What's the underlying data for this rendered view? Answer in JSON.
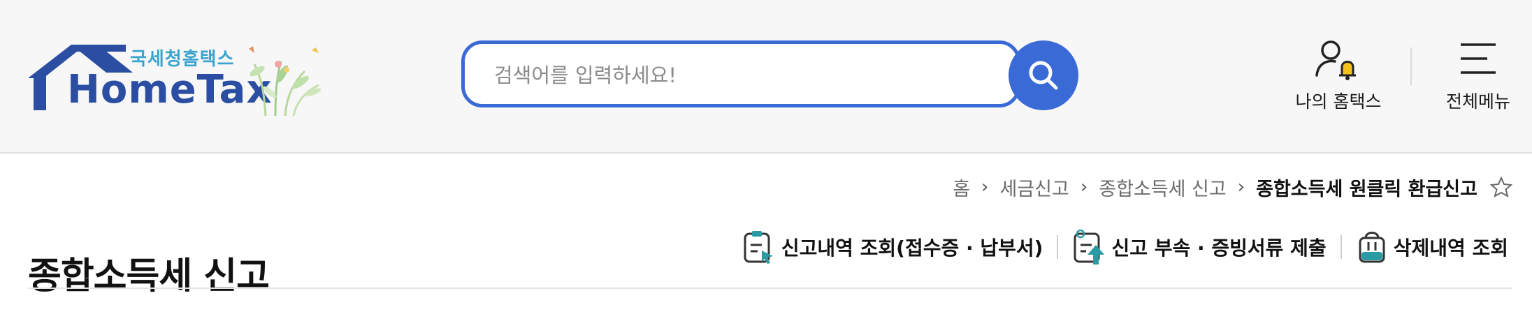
{
  "header": {
    "logo": {
      "small_text": "국세청홈택스",
      "main_text": "HomeTax"
    },
    "search": {
      "placeholder": "검색어를 입력하세요!"
    },
    "my_hometax": {
      "label": "나의 홈택스",
      "icon": "user-bell-icon"
    },
    "all_menu": {
      "label": "전체메뉴",
      "icon": "hamburger-icon"
    }
  },
  "breadcrumb": {
    "items": [
      "홈",
      "세금신고",
      "종합소득세 신고",
      "종합소득세 원클릭 환급신고"
    ]
  },
  "page": {
    "title": "종합소득세 신고",
    "actions": [
      {
        "label": "신고내역 조회(접수증 · 납부서)",
        "icon": "document-click-icon"
      },
      {
        "label": "신고 부속 · 증빙서류 제출",
        "icon": "document-upload-icon"
      },
      {
        "label": "삭제내역 조회",
        "icon": "trash-bin-icon"
      }
    ]
  },
  "colors": {
    "brand_blue": "#3a6ad6",
    "logo_blue": "#2b4ea2",
    "logo_cyan": "#3aa4cf",
    "accent_teal": "#2a9aa3",
    "bell_yellow": "#f4c21b"
  }
}
